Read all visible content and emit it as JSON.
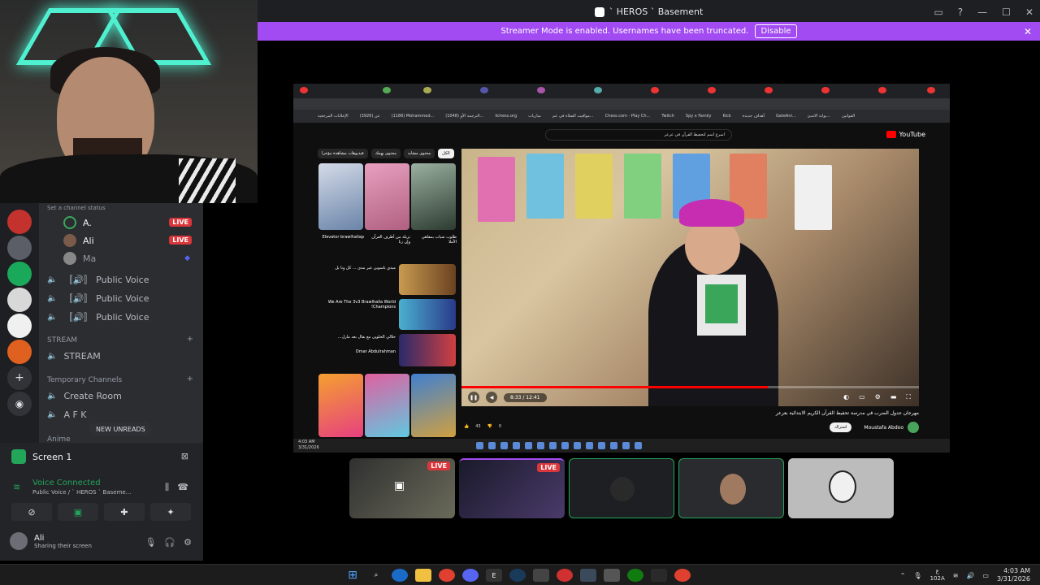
{
  "window": {
    "title": "` HEROS ` Basement"
  },
  "streamer_banner": {
    "text": "Streamer Mode is enabled. Usernames have been truncated.",
    "disable_label": "Disable"
  },
  "channels": {
    "status_placeholder": "Set a channel status",
    "members": [
      {
        "name": "A.",
        "live": "LIVE",
        "color": "#3ba55c"
      },
      {
        "name": "Ali",
        "live": "LIVE",
        "color": "#7a5b4a"
      },
      {
        "name": "Ma",
        "live": "",
        "color": "#888888"
      }
    ],
    "voice": [
      "Public Voice",
      "Public Voice",
      "Public Voice"
    ],
    "voice_prefix": "〚🔊〛",
    "categories": {
      "stream": "STREAM",
      "temporary": "Temporary Channels",
      "anime": "Anime"
    },
    "stream_channel": "STREAM",
    "temp_channels": [
      "Create Room",
      "A F K"
    ],
    "new_unreads": "NEW UNREADS"
  },
  "panel": {
    "screen_label": "Screen 1",
    "voice_connected": "Voice Connected",
    "voice_sub": "Public Voice / ` HEROS ` Baseme...",
    "user_name": "Ali",
    "user_status": "Sharing their screen"
  },
  "stream": {
    "bookmarks": [
      "الإعلانات المرجعية",
      "(3926) عن",
      "(1186) Mohammed...",
      "(1048) الترجمة الأو...",
      "lichess.org",
      "مباريات",
      "مواقيت الصلاة في عم...",
      "Chess.com - Play Ch...",
      "Twitch",
      "Spy x Family",
      "Kick",
      "أهداف جديدة",
      "GateAni...",
      "بوابة الاسئ...",
      "القوانين"
    ],
    "yt_logo": "YouTube",
    "search_text": "اسرع اسم لتحفيظ القرآن في عرعر",
    "chips": [
      "الكل",
      "محتوى مشابه",
      "محتوى يهمك",
      "فيديوهات مشاهدة مؤخرا"
    ],
    "rec_titles": [
      "Elevator brawlhallap",
      "نزيلة من أطرف الفرآن وإن زنا",
      "طلوب شباب بمقاهي الأملا",
      "مبدي باسوين عبر مدى ... كل ونا بل",
      "We Are The 3v3 Brawlhalla World Champions!",
      "حلالي الحلوين مع بقال بعد مارل...",
      "Omar Abdulrahman"
    ],
    "time": "8:33 / 12:41",
    "progress": 0.67,
    "video_title": "مهرجان جدول الضرب في مدرسة تحفيظ القرآن الكريم الابتدائية بعرعر",
    "channel_name": "Moustafa Abdoo",
    "subscribe": "اشتراك",
    "likes": "43",
    "dislikes": "0",
    "clock_time": "4:03 AM",
    "clock_date": "3/31/2026"
  },
  "tiles": [
    {
      "live": "LIVE"
    },
    {
      "live": "LIVE"
    },
    {
      "live": ""
    },
    {
      "live": ""
    },
    {
      "live": ""
    }
  ],
  "taskbar": {
    "time": "4:03 AM",
    "date": "3/31/2026",
    "lang_top": "ع",
    "lang_bottom": "102A"
  }
}
